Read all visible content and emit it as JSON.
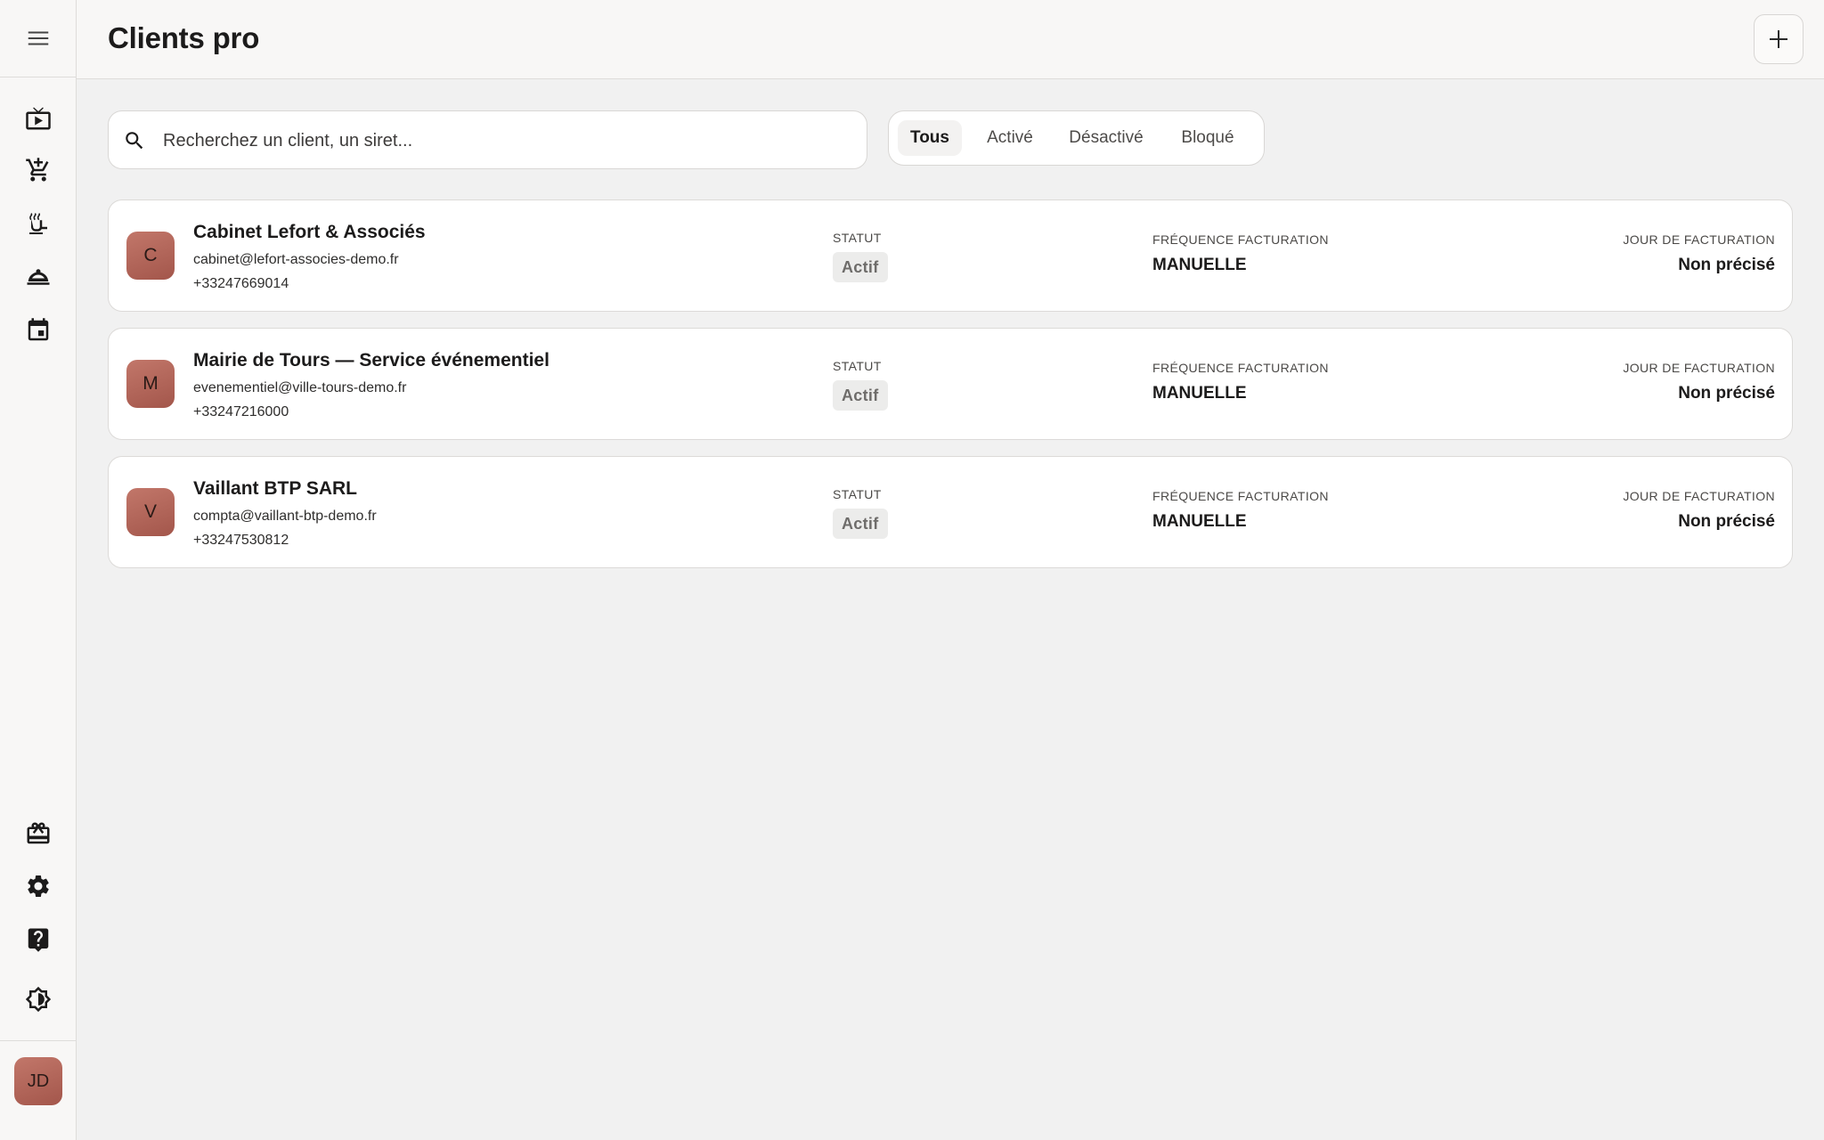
{
  "header": {
    "title": "Clients pro",
    "add_icon": "plus-icon"
  },
  "sidebar": {
    "top_items": [
      {
        "icon": "menu-icon"
      },
      {
        "icon": "live-tv-icon"
      },
      {
        "icon": "add-cart-icon"
      },
      {
        "icon": "kitchen-icon"
      },
      {
        "icon": "room-service-icon"
      },
      {
        "icon": "calendar-event-icon"
      }
    ],
    "bottom_items": [
      {
        "icon": "gift-card-icon"
      },
      {
        "icon": "settings-icon"
      },
      {
        "icon": "help-icon"
      },
      {
        "icon": "brightness-icon"
      }
    ],
    "user_initials": "JD"
  },
  "search": {
    "placeholder": "Recherchez un client, un siret...",
    "value": ""
  },
  "filters": {
    "selected": "Tous",
    "items": [
      "Tous",
      "Activé",
      "Désactivé",
      "Bloqué"
    ]
  },
  "columns": {
    "status": "STATUT",
    "frequency": "FRÉQUENCE FACTURATION",
    "billing_day": "JOUR DE FACTURATION"
  },
  "clients": [
    {
      "initial": "C",
      "name": "Cabinet Lefort & Associés",
      "email": "cabinet@lefort-associes-demo.fr",
      "phone": "+33247669014",
      "status": "Actif",
      "frequency": "MANUELLE",
      "billing_day": "Non précisé"
    },
    {
      "initial": "M",
      "name": "Mairie de Tours — Service événementiel",
      "email": "evenementiel@ville-tours-demo.fr",
      "phone": "+33247216000",
      "status": "Actif",
      "frequency": "MANUELLE",
      "billing_day": "Non précisé"
    },
    {
      "initial": "V",
      "name": "Vaillant BTP SARL",
      "email": "compta@vaillant-btp-demo.fr",
      "phone": "+33247530812",
      "status": "Actif",
      "frequency": "MANUELLE",
      "billing_day": "Non précisé"
    }
  ],
  "colors": {
    "avatar": "#b5665a",
    "background": "#f1f1f1",
    "surface": "#ffffff"
  }
}
